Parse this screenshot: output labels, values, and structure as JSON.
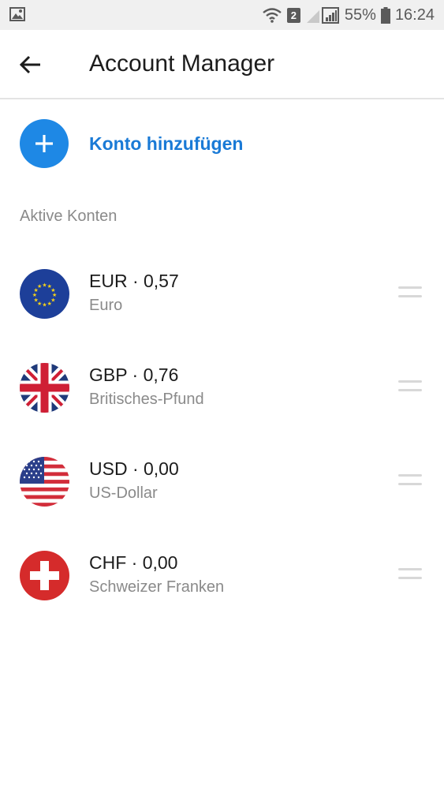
{
  "status_bar": {
    "battery": "55%",
    "time": "16:24",
    "sim": "2",
    "icons": [
      "image-icon",
      "wifi-icon",
      "sim-icon",
      "signal-icon",
      "battery-icon"
    ]
  },
  "header": {
    "title": "Account Manager",
    "back_icon": "back-arrow-icon"
  },
  "add_account": {
    "label": "Konto hinzufügen",
    "icon": "plus-icon",
    "accent": "#1e88e5"
  },
  "accounts_section": {
    "label": "Aktive Konten"
  },
  "accounts": [
    {
      "title": "EUR · 0,57",
      "subtitle": "Euro",
      "flag": "eu-flag-icon"
    },
    {
      "title": "GBP · 0,76",
      "subtitle": "Britisches-Pfund",
      "flag": "uk-flag-icon"
    },
    {
      "title": "USD · 0,00",
      "subtitle": "US-Dollar",
      "flag": "us-flag-icon"
    },
    {
      "title": "CHF · 0,00",
      "subtitle": "Schweizer Franken",
      "flag": "ch-flag-icon"
    }
  ]
}
